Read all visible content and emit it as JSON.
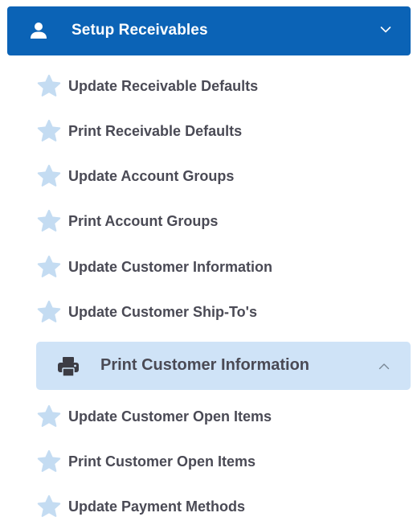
{
  "header": {
    "title": "Setup Receivables",
    "icon": "user-icon",
    "state_icon": "chevron-down-icon",
    "background": "#0b63b6"
  },
  "items": [
    {
      "label": "Update Receivable Defaults",
      "icon": "star-icon"
    },
    {
      "label": "Print Receivable Defaults",
      "icon": "star-icon"
    },
    {
      "label": "Update Account Groups",
      "icon": "star-icon"
    },
    {
      "label": "Print Account Groups",
      "icon": "star-icon"
    },
    {
      "label": "Update Customer Information",
      "icon": "star-icon"
    },
    {
      "label": "Update Customer Ship-To's",
      "icon": "star-icon"
    }
  ],
  "submenu": {
    "label": "Print Customer Information",
    "icon": "printer-icon",
    "state_icon": "chevron-up-icon",
    "background": "#cfe3f7"
  },
  "items_after": [
    {
      "label": "Update Customer Open Items",
      "icon": "star-icon"
    },
    {
      "label": "Print Customer Open Items",
      "icon": "star-icon"
    },
    {
      "label": "Update Payment Methods",
      "icon": "star-icon"
    }
  ]
}
